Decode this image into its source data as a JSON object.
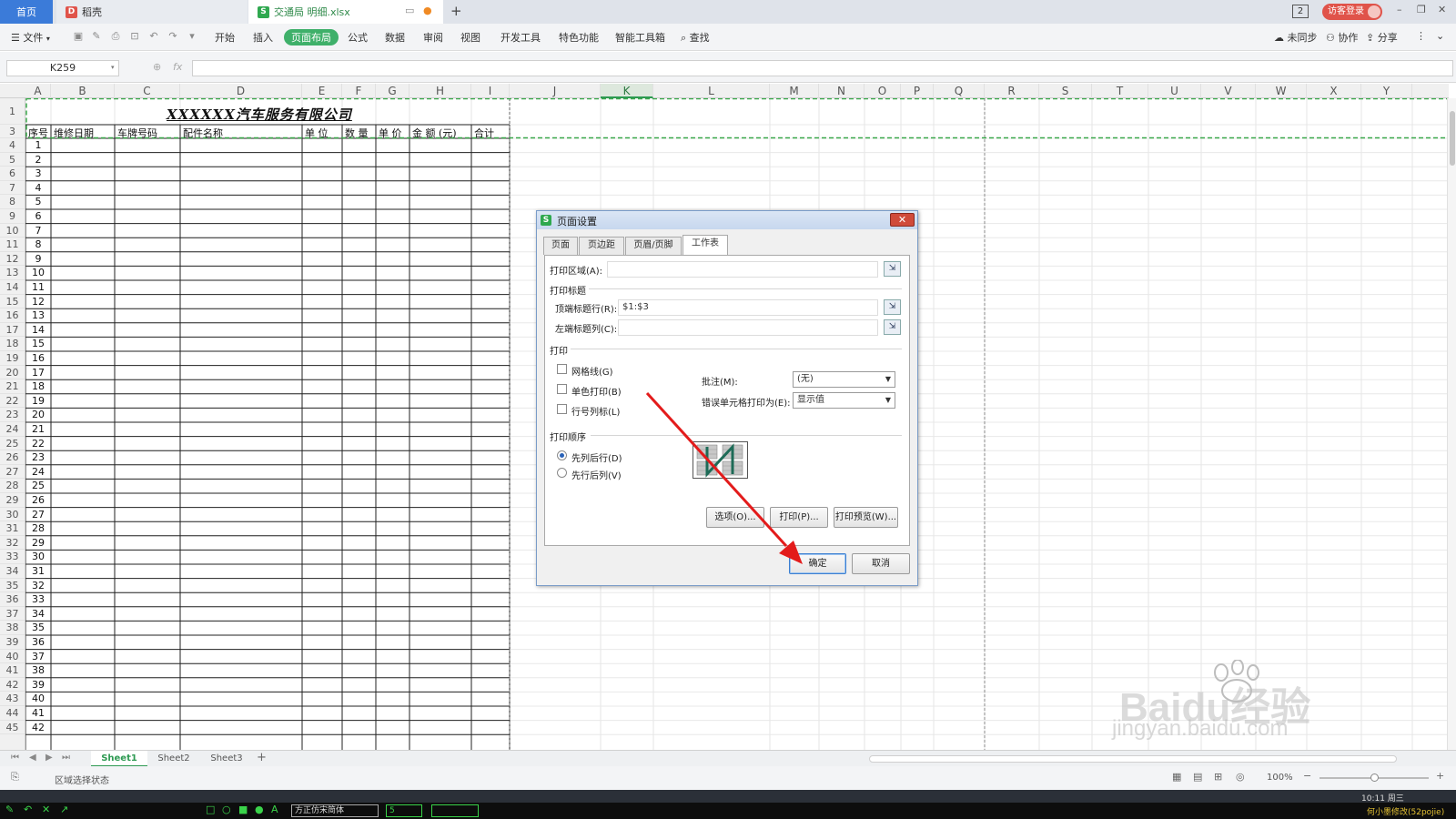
{
  "titlebar": {
    "home_tab": "首页",
    "daoke_tab": "稻壳",
    "file_tab": "交通局 明细.xlsx",
    "new_tab": "+",
    "badge_count": "2",
    "login_label": "访客登录"
  },
  "ribbon": {
    "file_menu": "文件",
    "menus": [
      "开始",
      "插入",
      "页面布局",
      "公式",
      "数据",
      "审阅",
      "视图",
      "开发工具",
      "特色功能",
      "智能工具箱",
      "查找"
    ],
    "sync_label": "未同步",
    "collab_label": "协作",
    "share_label": "分享"
  },
  "formula": {
    "name_box": "K259",
    "fx_label": "fx",
    "value": ""
  },
  "columns": [
    "A",
    "B",
    "C",
    "D",
    "E",
    "F",
    "G",
    "H",
    "I",
    "J",
    "K",
    "L",
    "M",
    "N",
    "O",
    "P",
    "Q",
    "R",
    "S",
    "T",
    "U",
    "V",
    "W",
    "X",
    "Y"
  ],
  "rows": [
    "1",
    "3",
    "4",
    "5",
    "6",
    "7",
    "8",
    "9",
    "10",
    "11",
    "12",
    "13",
    "14",
    "15",
    "16",
    "17",
    "18",
    "19",
    "20",
    "21",
    "22",
    "23",
    "24",
    "25",
    "26",
    "27",
    "28",
    "29",
    "30",
    "31",
    "32",
    "33",
    "34",
    "35",
    "36",
    "37",
    "38",
    "39",
    "40",
    "41",
    "42",
    "43",
    "44",
    "45"
  ],
  "sheet": {
    "title": "XXXXXX汽车服务有限公司",
    "headers": [
      "序号",
      "维修日期",
      "车牌号码",
      "配件名称",
      "单 位",
      "数 量",
      "单 价",
      "金 额 (元)",
      "合计"
    ],
    "serials": [
      "1",
      "2",
      "3",
      "4",
      "5",
      "6",
      "7",
      "8",
      "9",
      "10",
      "11",
      "12",
      "13",
      "14",
      "15",
      "16",
      "17",
      "18",
      "19",
      "20",
      "21",
      "22",
      "23",
      "24",
      "25",
      "26",
      "27",
      "28",
      "29",
      "30",
      "31",
      "32",
      "33",
      "34",
      "35",
      "36",
      "37",
      "38",
      "39",
      "40",
      "41",
      "42"
    ]
  },
  "sheet_tabs": [
    "Sheet1",
    "Sheet2",
    "Sheet3"
  ],
  "status": {
    "mode": "区域选择状态",
    "zoom": "100%"
  },
  "taskbar": {
    "font_name": "方正仿宋简体",
    "font_size": "5",
    "clock": "10:11 周三",
    "footer_note": "何小墨修改(52pojie)"
  },
  "dialog": {
    "title": "页面设置",
    "close": "✕",
    "tabs": [
      "页面",
      "页边距",
      "页眉/页脚",
      "工作表"
    ],
    "print_area_label": "打印区域(A):",
    "print_area_value": "",
    "print_titles_label": "打印标题",
    "top_rows_label": "顶端标题行(R):",
    "top_rows_value": "$1:$3",
    "left_cols_label": "左端标题列(C):",
    "left_cols_value": "",
    "print_section_label": "打印",
    "checkbox_gridlines": "网格线(G)",
    "checkbox_mono": "单色打印(B)",
    "checkbox_headings": "行号列标(L)",
    "comments_label": "批注(M):",
    "comments_value": "(无)",
    "errors_label": "错误单元格打印为(E):",
    "errors_value": "显示值",
    "order_label": "打印顺序",
    "order_down_then_over": "先列后行(D)",
    "order_over_then_down": "先行后列(V)",
    "options_button": "选项(O)...",
    "print_button": "打印(P)...",
    "preview_button": "打印预览(W)...",
    "ok_button": "确定",
    "cancel_button": "取消"
  },
  "watermark": {
    "logo": "Baidu经验",
    "url": "jingyan.baidu.com"
  },
  "colors": {
    "accent_green": "#3fb06a",
    "home_tab_blue": "#3b7bd9",
    "login_red": "#e0534a",
    "annotation_arrow": "#e31b1b",
    "print_title_dash": "#3aa84a"
  }
}
